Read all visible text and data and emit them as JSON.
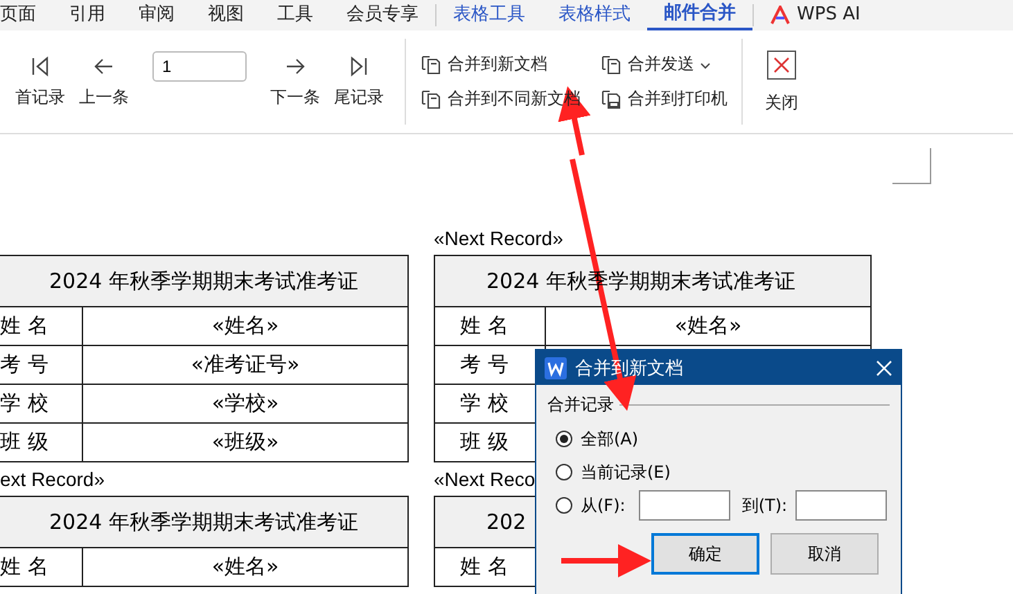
{
  "tabs": [
    {
      "label": "页面",
      "kind": "main",
      "selected": false
    },
    {
      "label": "引用",
      "kind": "main",
      "selected": false
    },
    {
      "label": "审阅",
      "kind": "main",
      "selected": false
    },
    {
      "label": "视图",
      "kind": "main",
      "selected": false
    },
    {
      "label": "工具",
      "kind": "main",
      "selected": false
    },
    {
      "label": "会员专享",
      "kind": "main",
      "selected": false
    },
    {
      "label": "表格工具",
      "kind": "context",
      "selected": false
    },
    {
      "label": "表格样式",
      "kind": "context",
      "selected": false
    },
    {
      "label": "邮件合并",
      "kind": "context",
      "selected": true
    },
    {
      "label": "WPS AI",
      "kind": "ai",
      "selected": false
    }
  ],
  "ribbon": {
    "navigation": [
      {
        "kind": "first",
        "label": "首记录"
      },
      {
        "kind": "prev",
        "label": "上一条"
      },
      {
        "kind": "field",
        "value": "1"
      },
      {
        "kind": "next",
        "label": "下一条"
      },
      {
        "kind": "last",
        "label": "尾记录"
      }
    ],
    "merge": [
      {
        "kind": "new-doc",
        "label": "合并到新文档"
      },
      {
        "kind": "send",
        "label": "合并发送"
      },
      {
        "kind": "diff-doc",
        "label": "合并到不同新文档"
      },
      {
        "kind": "printer",
        "label": "合并到打印机"
      }
    ],
    "close": {
      "label": "关闭"
    }
  },
  "document": {
    "left": {
      "cards": [
        {
          "title": "2024 年秋季学期期末考试准考证",
          "rows": [
            {
              "label": "姓 名",
              "value": "«姓名»"
            },
            {
              "label": "考 号",
              "value": "«准考证号»"
            },
            {
              "label": "学 校",
              "value": "«学校»"
            },
            {
              "label": "班 级",
              "value": "«班级»"
            }
          ],
          "after": "ext Record»"
        },
        {
          "title": "2024 年秋季学期期末考试准考证",
          "rows": [
            {
              "label": "姓 名",
              "value": "«姓名»"
            }
          ]
        }
      ]
    },
    "right": {
      "before": "«Next Record»",
      "cards": [
        {
          "title": "2024 年秋季学期期末考试准考证",
          "rows": [
            {
              "label": "姓 名",
              "value": "«姓名»"
            },
            {
              "label": "考 号"
            },
            {
              "label": "学 校"
            },
            {
              "label": "班 级"
            }
          ],
          "after": "«Next Reco"
        },
        {
          "title": "202",
          "rows": [
            {
              "label": "姓 名"
            }
          ]
        }
      ]
    }
  },
  "dialog": {
    "title": "合并到新文档",
    "group": "合并记录",
    "options": [
      {
        "kind": "plain",
        "label": "全部(A)",
        "selected": true
      },
      {
        "kind": "plain",
        "label": "当前记录(E)",
        "selected": false
      },
      {
        "kind": "range",
        "label": "从(F):",
        "to_label": "到(T):",
        "selected": false
      }
    ],
    "buttons": [
      {
        "label": "确定",
        "default": true
      },
      {
        "label": "取消",
        "default": false
      }
    ]
  }
}
